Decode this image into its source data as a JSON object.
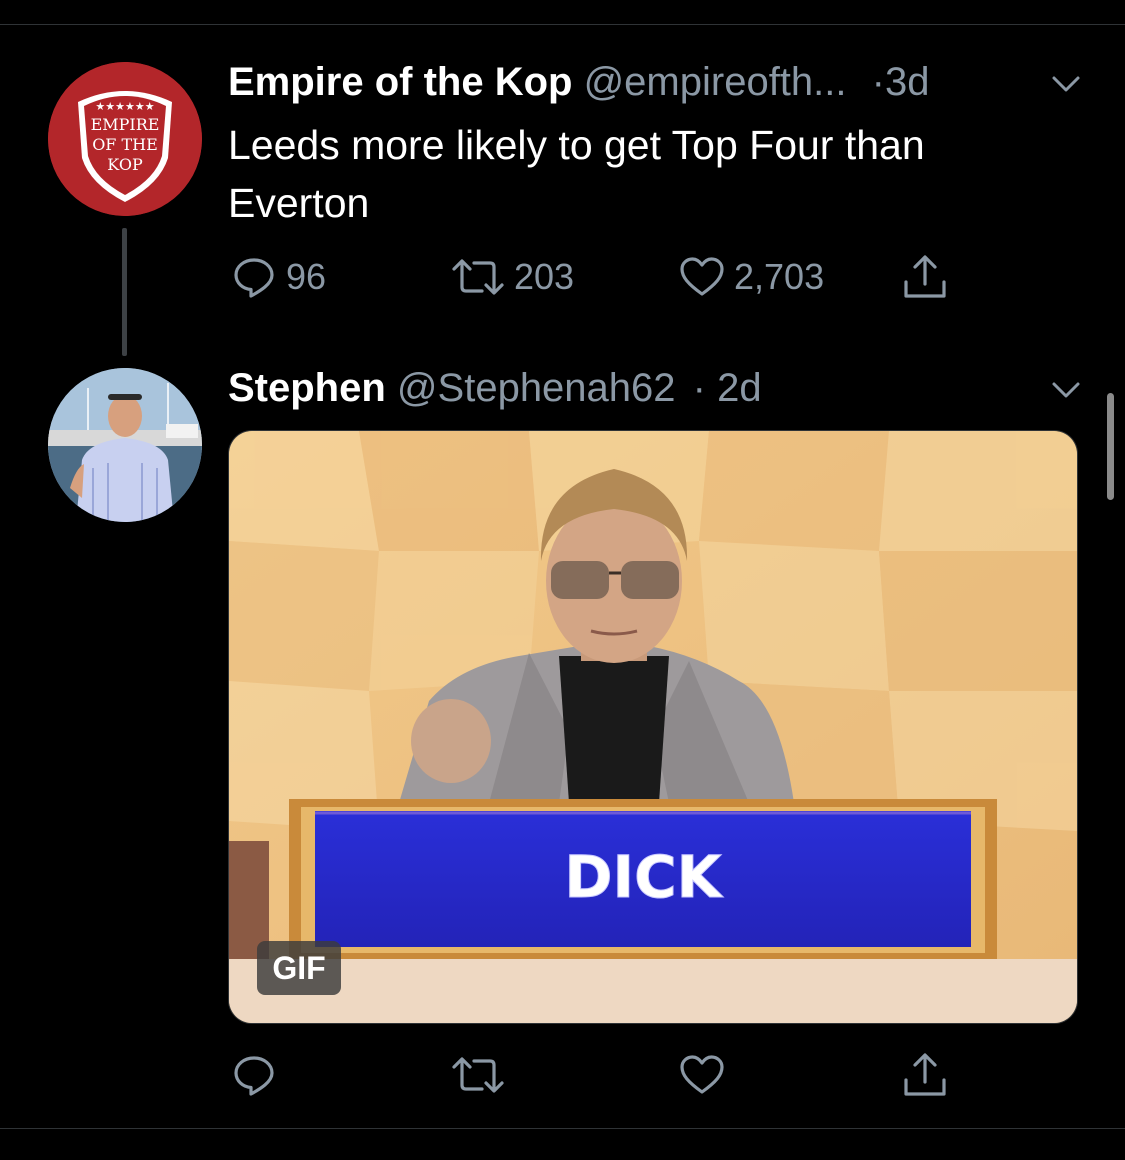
{
  "tweets": [
    {
      "display_name": "Empire of the Kop",
      "handle": "@empireofth...",
      "separator": "·",
      "time": "3d",
      "text": "Leeds more likely to get Top Four than Everton",
      "avatar": {
        "badge_lines": [
          "EMPIRE",
          "OF THE",
          "KOP"
        ],
        "stars": "★★★★★★",
        "color": "#b3262a"
      },
      "actions": {
        "replies": "96",
        "retweets": "203",
        "likes": "2,703"
      }
    },
    {
      "display_name": "Stephen",
      "handle": "@Stephenah62",
      "separator": "·",
      "time": "2d",
      "media": {
        "type": "GIF",
        "badge": "GIF",
        "caption_plate": "DICK"
      }
    }
  ],
  "icons": {
    "reply": "reply-icon",
    "retweet": "retweet-icon",
    "like": "heart-icon",
    "share": "share-icon",
    "menu": "chevron-down-icon"
  },
  "colors": {
    "background": "#000000",
    "text_primary": "#ffffff",
    "text_secondary": "#8b98a5",
    "divider": "#2f3336"
  }
}
